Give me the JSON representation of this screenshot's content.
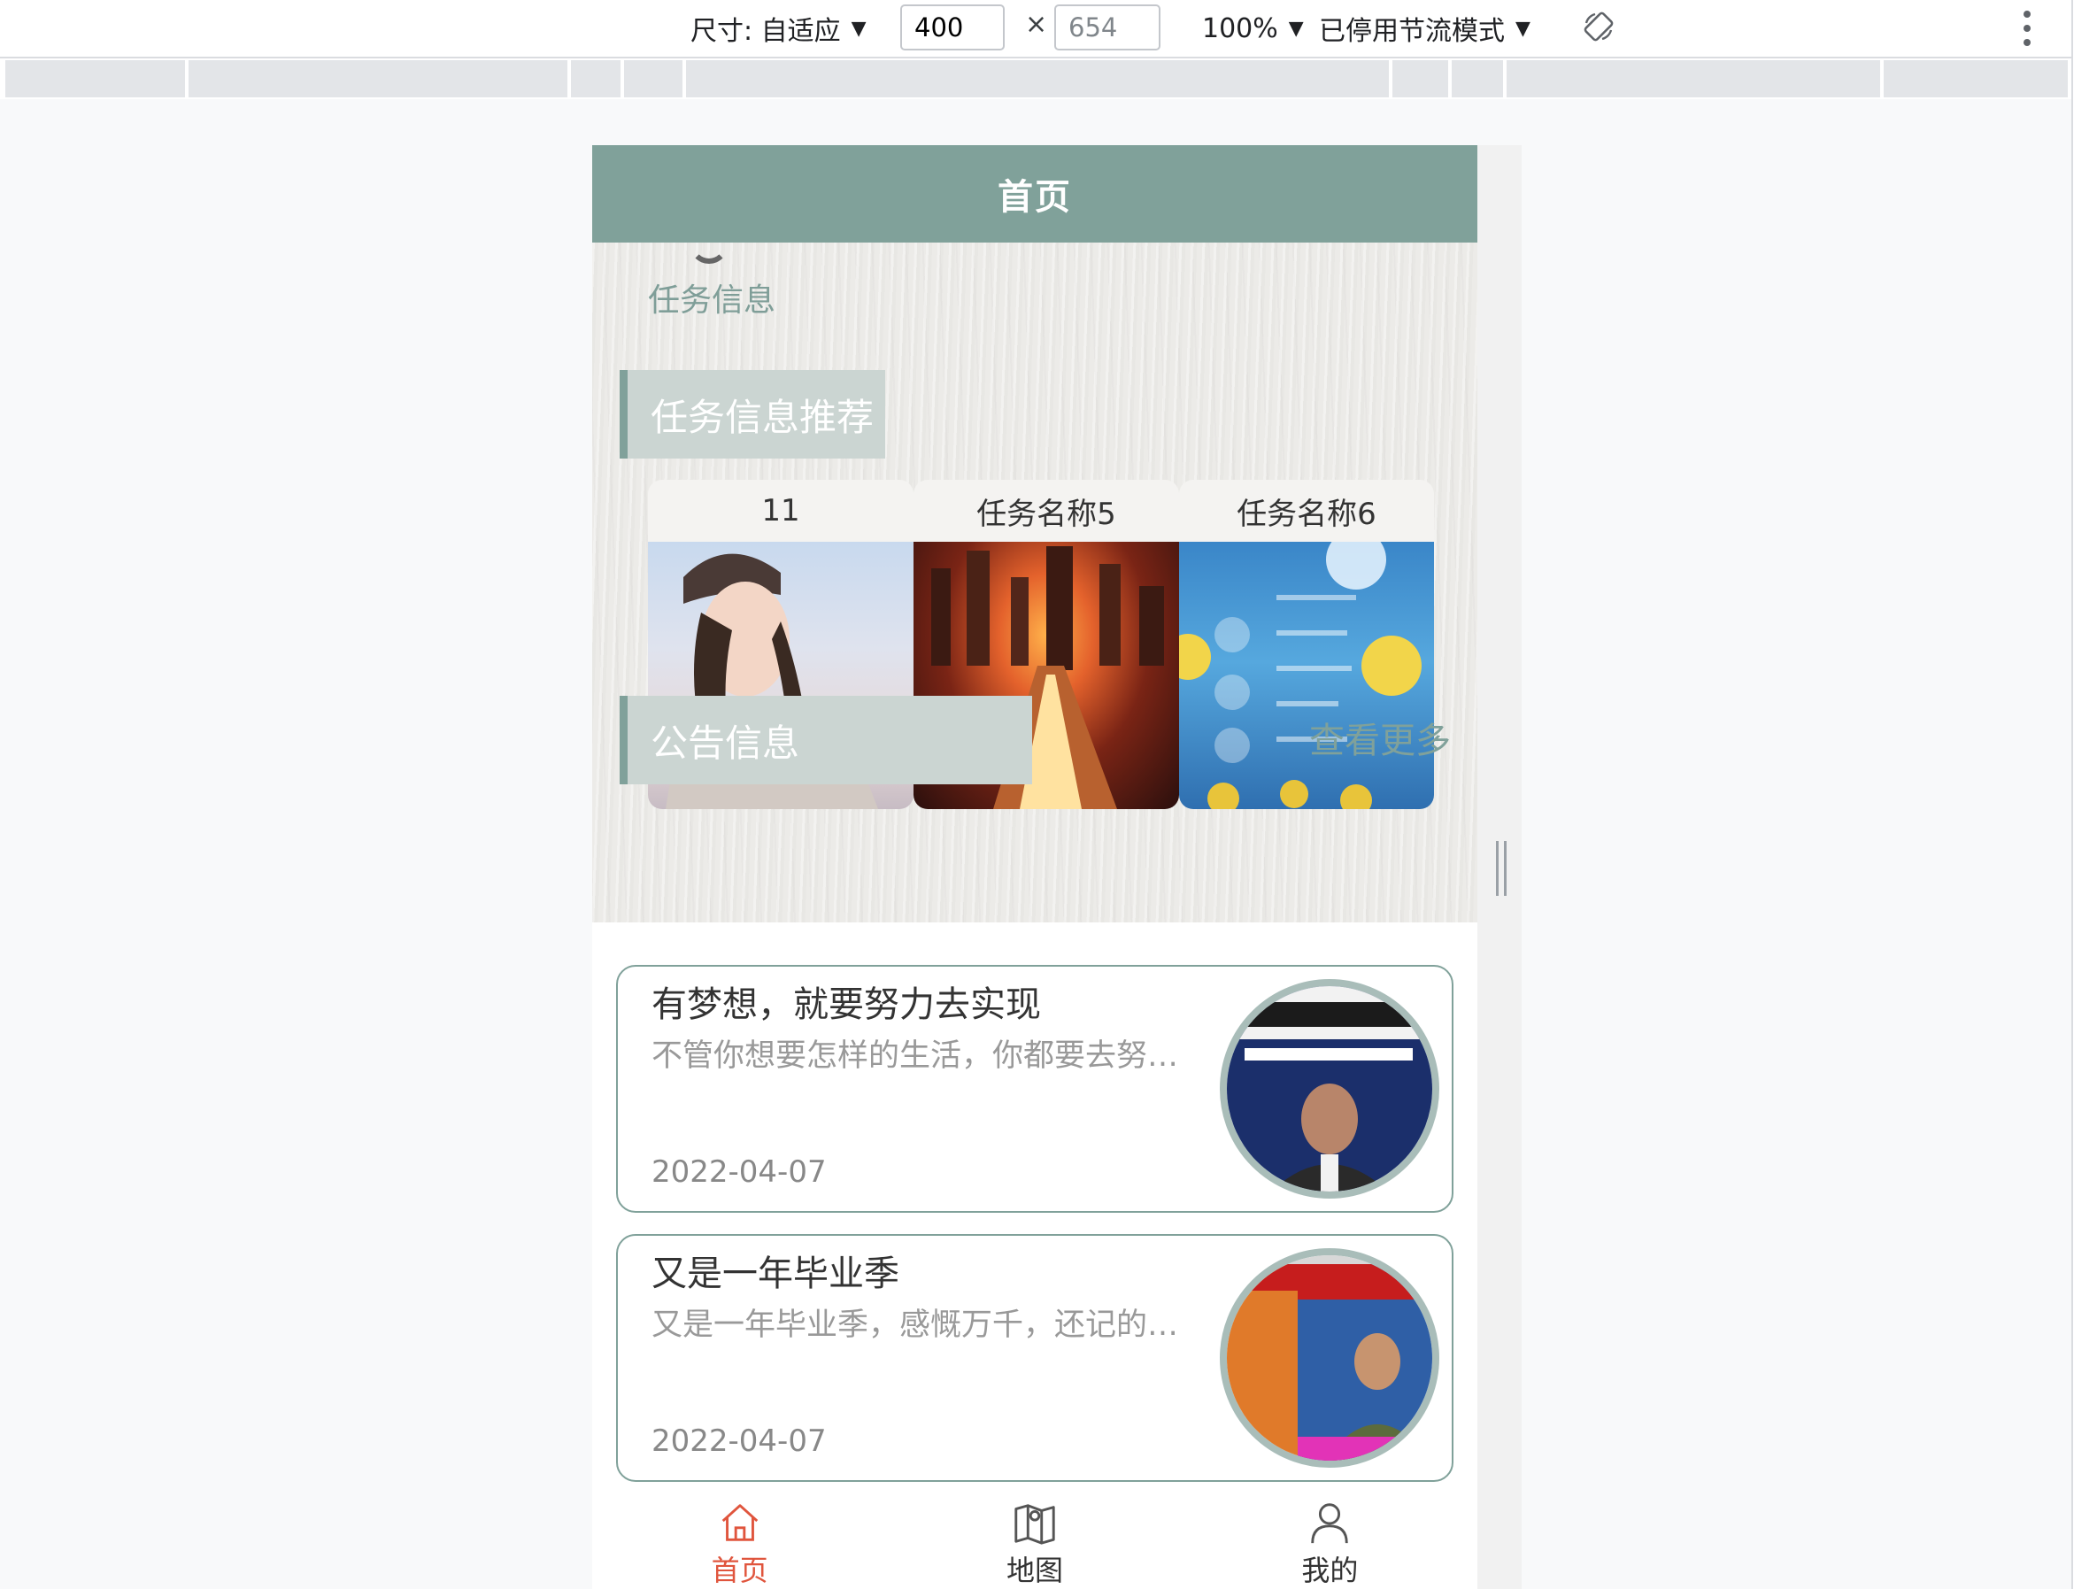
{
  "devtools": {
    "dimensions_label": "尺寸: 自适应",
    "width_value": "400",
    "height_value": "654",
    "times": "×",
    "zoom_label": "100%",
    "throttle_label": "已停用节流模式"
  },
  "app": {
    "page_title": "首页",
    "task_info_link": "任务信息",
    "recommend_title": "任务信息推荐",
    "recommendations": [
      {
        "title": "11"
      },
      {
        "title": "任务名称5"
      },
      {
        "title": "任务名称6"
      }
    ],
    "notice_title": "公告信息",
    "more_label": "查看更多",
    "notices": [
      {
        "title": "有梦想，就要努力去实现",
        "desc": "不管你想要怎样的生活，你都要去努力争取",
        "date": "2022-04-07"
      },
      {
        "title": "又是一年毕业季",
        "desc": "又是一年毕业季，感慨万千，还记的那年",
        "date": "2022-04-07"
      }
    ],
    "tabs": [
      {
        "label": "首页",
        "icon": "home-icon",
        "active": true
      },
      {
        "label": "地图",
        "icon": "map-icon",
        "active": false
      },
      {
        "label": "我的",
        "icon": "user-icon",
        "active": false
      }
    ]
  },
  "colors": {
    "brand": "#80a19a",
    "active_tab": "#e0553d"
  }
}
